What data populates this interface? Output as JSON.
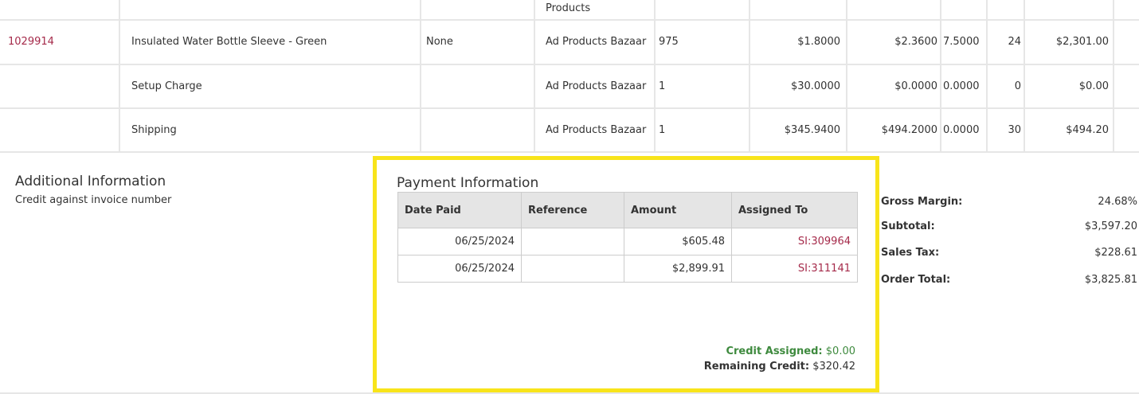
{
  "line_items": {
    "partial_row": {
      "vendor": "Products"
    },
    "rows": [
      {
        "item_number": "1029914",
        "description": "Insulated Water Bottle Sleeve - Green",
        "decoration": "None",
        "vendor": "Ad Products Bazaar",
        "quantity": "975",
        "cost": "$1.8000",
        "price": "$2.3600",
        "factor": "7.5000",
        "days": "24",
        "total": "$2,301.00"
      },
      {
        "item_number": "",
        "description": "Setup Charge",
        "decoration": "",
        "vendor": "Ad Products Bazaar",
        "quantity": "1",
        "cost": "$30.0000",
        "price": "$0.0000",
        "factor": "0.0000",
        "days": "0",
        "total": "$0.00"
      },
      {
        "item_number": "",
        "description": "Shipping",
        "decoration": "",
        "vendor": "Ad Products Bazaar",
        "quantity": "1",
        "cost": "$345.9400",
        "price": "$494.2000",
        "factor": "0.0000",
        "days": "30",
        "total": "$494.20"
      }
    ]
  },
  "additional_info": {
    "title": "Additional Information",
    "text": "Credit against invoice number"
  },
  "payment": {
    "title": "Payment Information",
    "headers": {
      "date_paid": "Date Paid",
      "reference": "Reference",
      "amount": "Amount",
      "assigned_to": "Assigned To"
    },
    "rows": [
      {
        "date_paid": "06/25/2024",
        "reference": "",
        "amount": "$605.48",
        "assigned_to": "SI:309964"
      },
      {
        "date_paid": "06/25/2024",
        "reference": "",
        "amount": "$2,899.91",
        "assigned_to": "SI:311141"
      }
    ],
    "credit_assigned_label": "Credit Assigned:",
    "credit_assigned_value": "$0.00",
    "remaining_credit_label": "Remaining Credit:",
    "remaining_credit_value": "$320.42"
  },
  "totals": {
    "gross_margin_label": "Gross Margin:",
    "gross_margin_value": "24.68%",
    "subtotal_label": "Subtotal:",
    "subtotal_value": "$3,597.20",
    "sales_tax_label": "Sales Tax:",
    "sales_tax_value": "$228.61",
    "order_total_label": "Order Total:",
    "order_total_value": "$3,825.81"
  },
  "colors": {
    "highlight_border": "#f8e41a",
    "link": "#a52a4a",
    "credit_assigned": "#3e8a3e",
    "grid_line": "#e6e6e6",
    "header_bg": "#e5e5e5"
  }
}
